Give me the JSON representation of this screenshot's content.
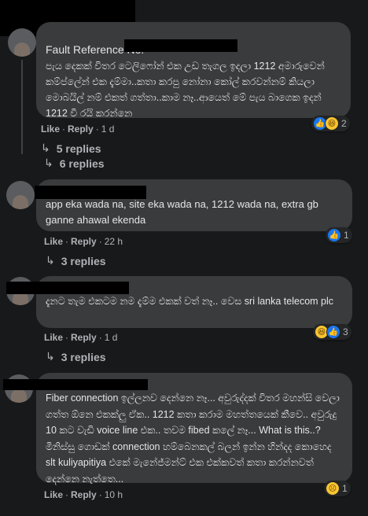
{
  "comments": [
    {
      "author": "",
      "text": "Fault Reference No:",
      "body": "පැය දෙකක් විතර ටෙලිෆෝන් එක උඩ තැගල ඉදලා 1212 අමාරුවෙන් කම්ප්ලේන් එක දැම්මා..කතා කරපු නෝනා කෝල් කරවන්නම් කියලා මොබයිල් නම් එකත් ගත්තා..කාම නෑ..ආයෙත් මේ පැය බාගෙක ඉදන් 1212 වී රයි කරන්නෙ",
      "like": "Like",
      "reply": "Reply",
      "time": "1 d",
      "reaction_count": "2",
      "replies": [
        "5 replies",
        "6 replies"
      ]
    },
    {
      "text": "app eka wada na, site eka wada na, 1212 wada na, extra gb ganne ahawal ekenda",
      "like": "Like",
      "reply": "Reply",
      "time": "22 h",
      "reaction_count": "1",
      "replies": [
        "3 replies"
      ]
    },
    {
      "text": "දැනට තැම එකටම නම දැම්ම එකක් වත් නෑ.. වෙස sri lanka telecom plc",
      "like": "Like",
      "reply": "Reply",
      "time": "1 d",
      "reaction_count": "3",
      "replies": [
        "3 replies"
      ]
    },
    {
      "text": "Fiber connection ඉල්ලනව දෙන්නෙ නෑ... අවුරුද්දක් විතර මහන්සි වෙලා ගත්ත ඕනෙ එකක්ලු ඒක.. 1212 කතා කරාම මහත්තයෙක් කීවෙ.. අවුරුදු 10 කට වැඩි voice line එක.. තවම fibed කලේ නෑ... What is this..? මිනිස්සු ගොඩක් connection හම්බෙනකල් බලන් ඉන්න හින්දද කොහෙද slt kuliyapitiya එකේ මැනේජ්මන්ට් එක එක්කවත් කතා කරන්නවත් දෙන්නෙ නැත්තෙ...",
      "like": "Like",
      "reply": "Reply",
      "time": "10 h",
      "reaction_count": "1"
    }
  ],
  "separator": "·",
  "colors": {
    "background": "#18191a",
    "bubble": "#3a3b3c",
    "text": "#e4e6eb",
    "secondary": "#b0b3b8",
    "like_blue": "#1877f2"
  }
}
